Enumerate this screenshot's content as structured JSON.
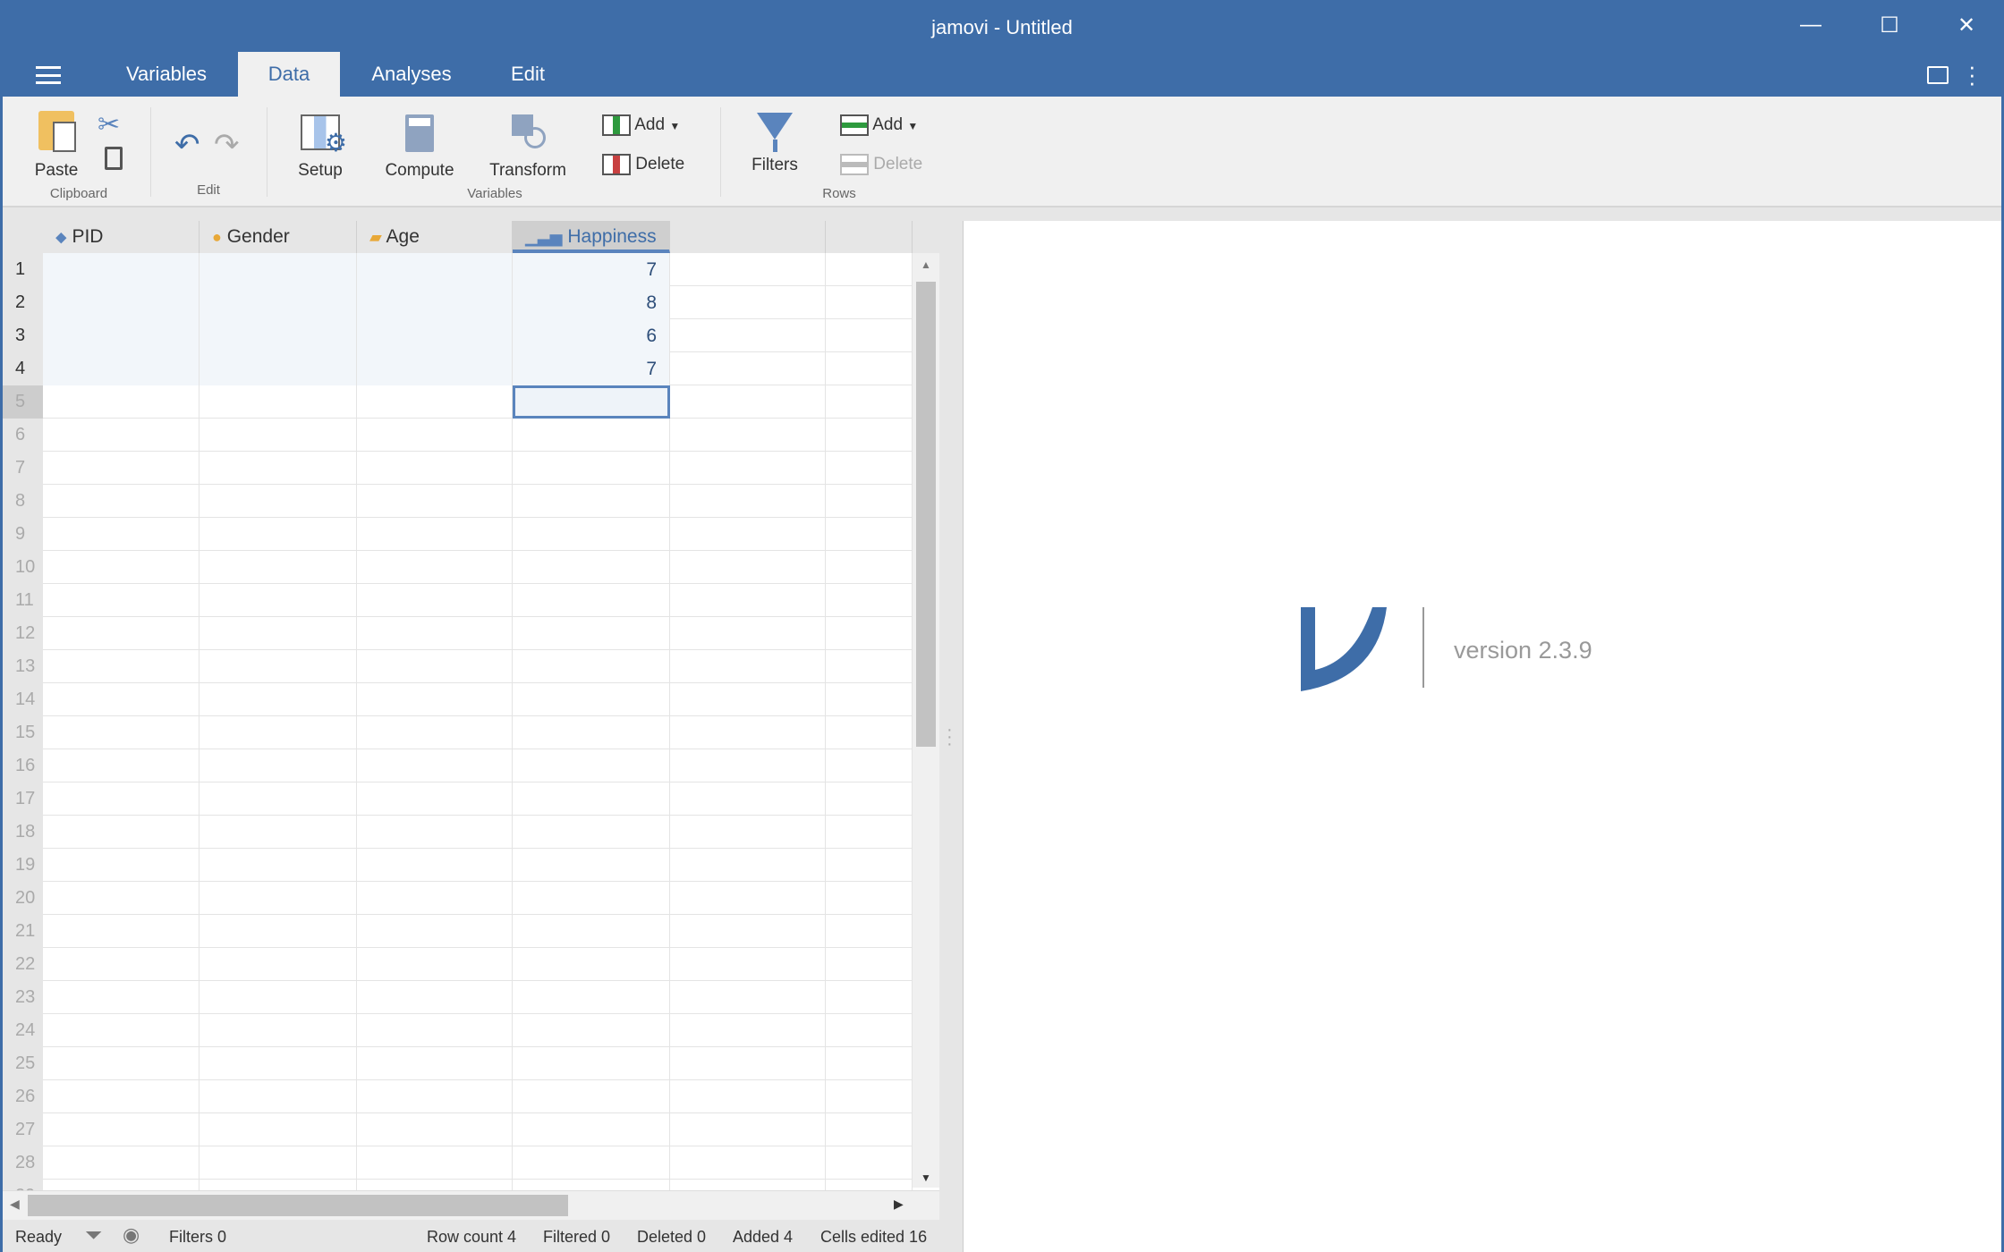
{
  "window": {
    "title": "jamovi - Untitled",
    "minimize": "—",
    "maximize": "☐",
    "close": "✕"
  },
  "tabs": [
    {
      "label": "Variables"
    },
    {
      "label": "Data",
      "active": true
    },
    {
      "label": "Analyses"
    },
    {
      "label": "Edit"
    }
  ],
  "ribbon": {
    "paste": "Paste",
    "clipboard": "Clipboard",
    "edit": "Edit",
    "setup": "Setup",
    "compute": "Compute",
    "transform": "Transform",
    "var_add": "Add",
    "var_delete": "Delete",
    "variables": "Variables",
    "filters": "Filters",
    "row_add": "Add",
    "row_delete": "Delete",
    "rows": "Rows"
  },
  "columns": [
    {
      "name": "PID",
      "icon": "nominal-id-icon"
    },
    {
      "name": "Gender",
      "icon": "nominal-text-icon"
    },
    {
      "name": "Age",
      "icon": "continuous-ruler-icon"
    },
    {
      "name": "Happiness",
      "icon": "ordinal-bar-icon",
      "selected": true
    }
  ],
  "rows": [
    [
      "",
      "",
      "",
      "7"
    ],
    [
      "",
      "",
      "",
      "8"
    ],
    [
      "",
      "",
      "",
      "6"
    ],
    [
      "",
      "",
      "",
      "7"
    ]
  ],
  "visible_row_count": 29,
  "selected_row": 5,
  "results": {
    "version": "version 2.3.9"
  },
  "status": {
    "ready": "Ready",
    "filters": "Filters 0",
    "row_count": "Row count 4",
    "filtered": "Filtered 0",
    "deleted": "Deleted 0",
    "added": "Added 4",
    "cells_edited": "Cells edited 16"
  },
  "colors": {
    "brand": "#3e6da8",
    "selection": "#5a84bd"
  }
}
